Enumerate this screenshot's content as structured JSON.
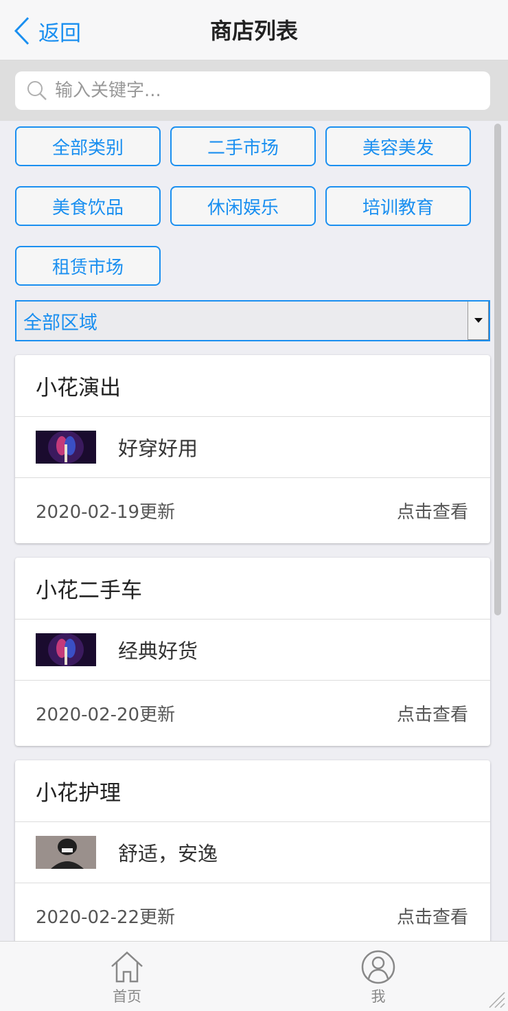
{
  "header": {
    "back_label": "返回",
    "title": "商店列表"
  },
  "search": {
    "placeholder": "输入关键字..."
  },
  "categories": [
    "全部类别",
    "二手市场",
    "美容美发",
    "美食饮品",
    "休闲娱乐",
    "培训教育",
    "租赁市场"
  ],
  "region_select": {
    "selected": "全部区域"
  },
  "shops": [
    {
      "name": "小花演出",
      "desc": "好穿好用",
      "updated": "2020-02-19更新",
      "action": "点击查看"
    },
    {
      "name": "小花二手车",
      "desc": "经典好货",
      "updated": "2020-02-20更新",
      "action": "点击查看"
    },
    {
      "name": "小花护理",
      "desc": "舒适，安逸",
      "updated": "2020-02-22更新",
      "action": "点击查看"
    }
  ],
  "tabbar": {
    "home_label": "首页",
    "me_label": "我"
  },
  "colors": {
    "accent": "#1a8ff0",
    "nav_bg": "#f7f7f8",
    "page_bg": "#eeeef3"
  },
  "icons": [
    "chevron-left-icon",
    "search-icon",
    "dropdown-arrow-icon",
    "home-icon",
    "user-icon"
  ]
}
